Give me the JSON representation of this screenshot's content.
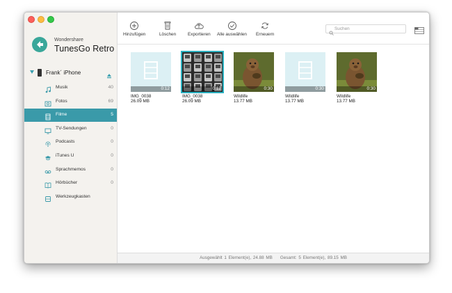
{
  "app": {
    "brand_small": "Wondershare",
    "brand_name": "TunesGo Retro",
    "accent": "#3a9aa9"
  },
  "device": {
    "name": "Frank´ iPhone"
  },
  "sidebar": {
    "items": [
      {
        "label": "Musik",
        "count": "40",
        "icon": "music-note-icon"
      },
      {
        "label": "Fotos",
        "count": "69",
        "icon": "photo-icon"
      },
      {
        "label": "Filme",
        "count": "5",
        "icon": "film-icon",
        "active": true
      },
      {
        "label": "TV-Sendungen",
        "count": "0",
        "icon": "tv-icon"
      },
      {
        "label": "Podcasts",
        "count": "0",
        "icon": "podcast-icon"
      },
      {
        "label": "iTunes U",
        "count": "0",
        "icon": "graduation-cap-icon"
      },
      {
        "label": "Sprachmemos",
        "count": "0",
        "icon": "voicemail-icon"
      },
      {
        "label": "Hörbücher",
        "count": "0",
        "icon": "book-icon"
      },
      {
        "label": "Werkzeugkasten",
        "count": "",
        "icon": "toolbox-icon"
      }
    ]
  },
  "toolbar": {
    "add": "Hinzufügen",
    "delete": "Löschen",
    "export": "Exportieren",
    "select_all": "Alle auswählen",
    "refresh": "Erneuern",
    "search_placeholder": "Suchen"
  },
  "files": [
    {
      "name": "IMG_0038",
      "size": "26.09 MB",
      "duration": "0:12",
      "thumb": "placeholder"
    },
    {
      "name": "IMG_0038",
      "size": "26.09 MB",
      "duration": "0:12",
      "thumb": "phones",
      "selected": true
    },
    {
      "name": "Wildlife",
      "size": "13.77 MB",
      "duration": "0:30",
      "thumb": "marmot"
    },
    {
      "name": "Wildlife",
      "size": "13.77 MB",
      "duration": "0:30",
      "thumb": "placeholder"
    },
    {
      "name": "Wildlife",
      "size": "13.77 MB",
      "duration": "0:30",
      "thumb": "marmot"
    }
  ],
  "status": {
    "selected": "Ausgewählt 1 Element(e), 24.88 MB",
    "total": "Gesamt: 5 Element(e), 89.15 MB"
  }
}
